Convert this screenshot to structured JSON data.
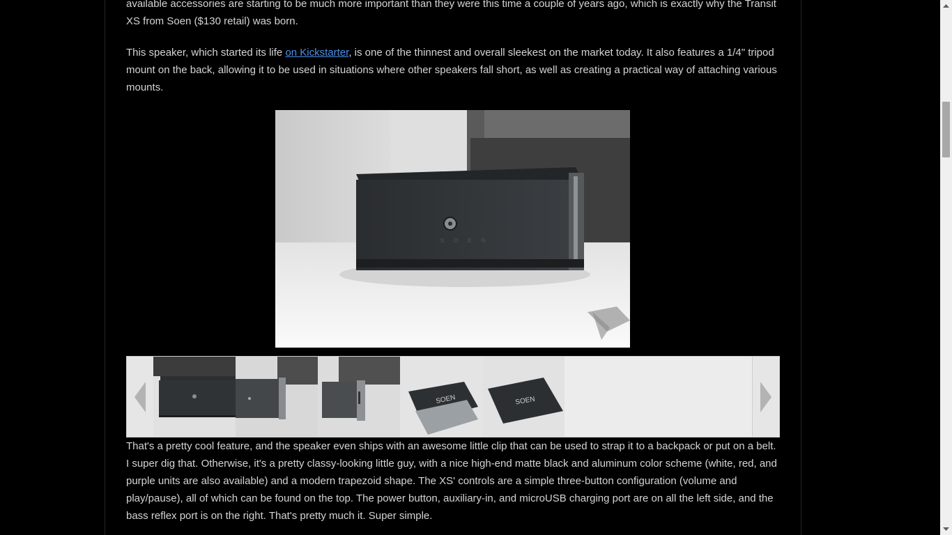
{
  "article": {
    "paragraph1": "available accessories are starting to be much more important than they were this time a couple of years ago, which is exactly why the Transit XS from Soen ($130 retail) was born.",
    "paragraph2": {
      "before": "This speaker, which started its life ",
      "link_text": "on Kickstarter",
      "after": ", is one of the thinnest and overall sleekest on the market today. It also features a 1/4\" tripod mount on the back, allowing it to be used in situations where other speakers fall short, as well as creating a practical way of attaching various mounts."
    },
    "paragraph3": "That's a pretty cool feature, and the speaker even ships with an awesome little clip that can be used to strap it to a backpack or put on a belt. I super dig that. Otherwise, it's a pretty classy-looking little guy, with a nice high-end matte black and aluminum color scheme (white, red, and purple units are also available) and a modern trapezoid shape. The XS' controls are a simple three-button configuration (volume and play/pause), all of which can be found on the top. The power button, auxiliary-in, and microUSB charging port are on all the left side, and the bass reflex port is on the right. That's pretty much it. Super simple."
  },
  "gallery": {
    "thumbnail_count": 5,
    "thumb_label": "SOEN"
  },
  "colors": {
    "background": "#000000",
    "text": "#d4d4d4",
    "link": "#4b8fe6",
    "gallery_bg": "#ececec",
    "scrollbar_thumb": "#a8a8a8"
  }
}
